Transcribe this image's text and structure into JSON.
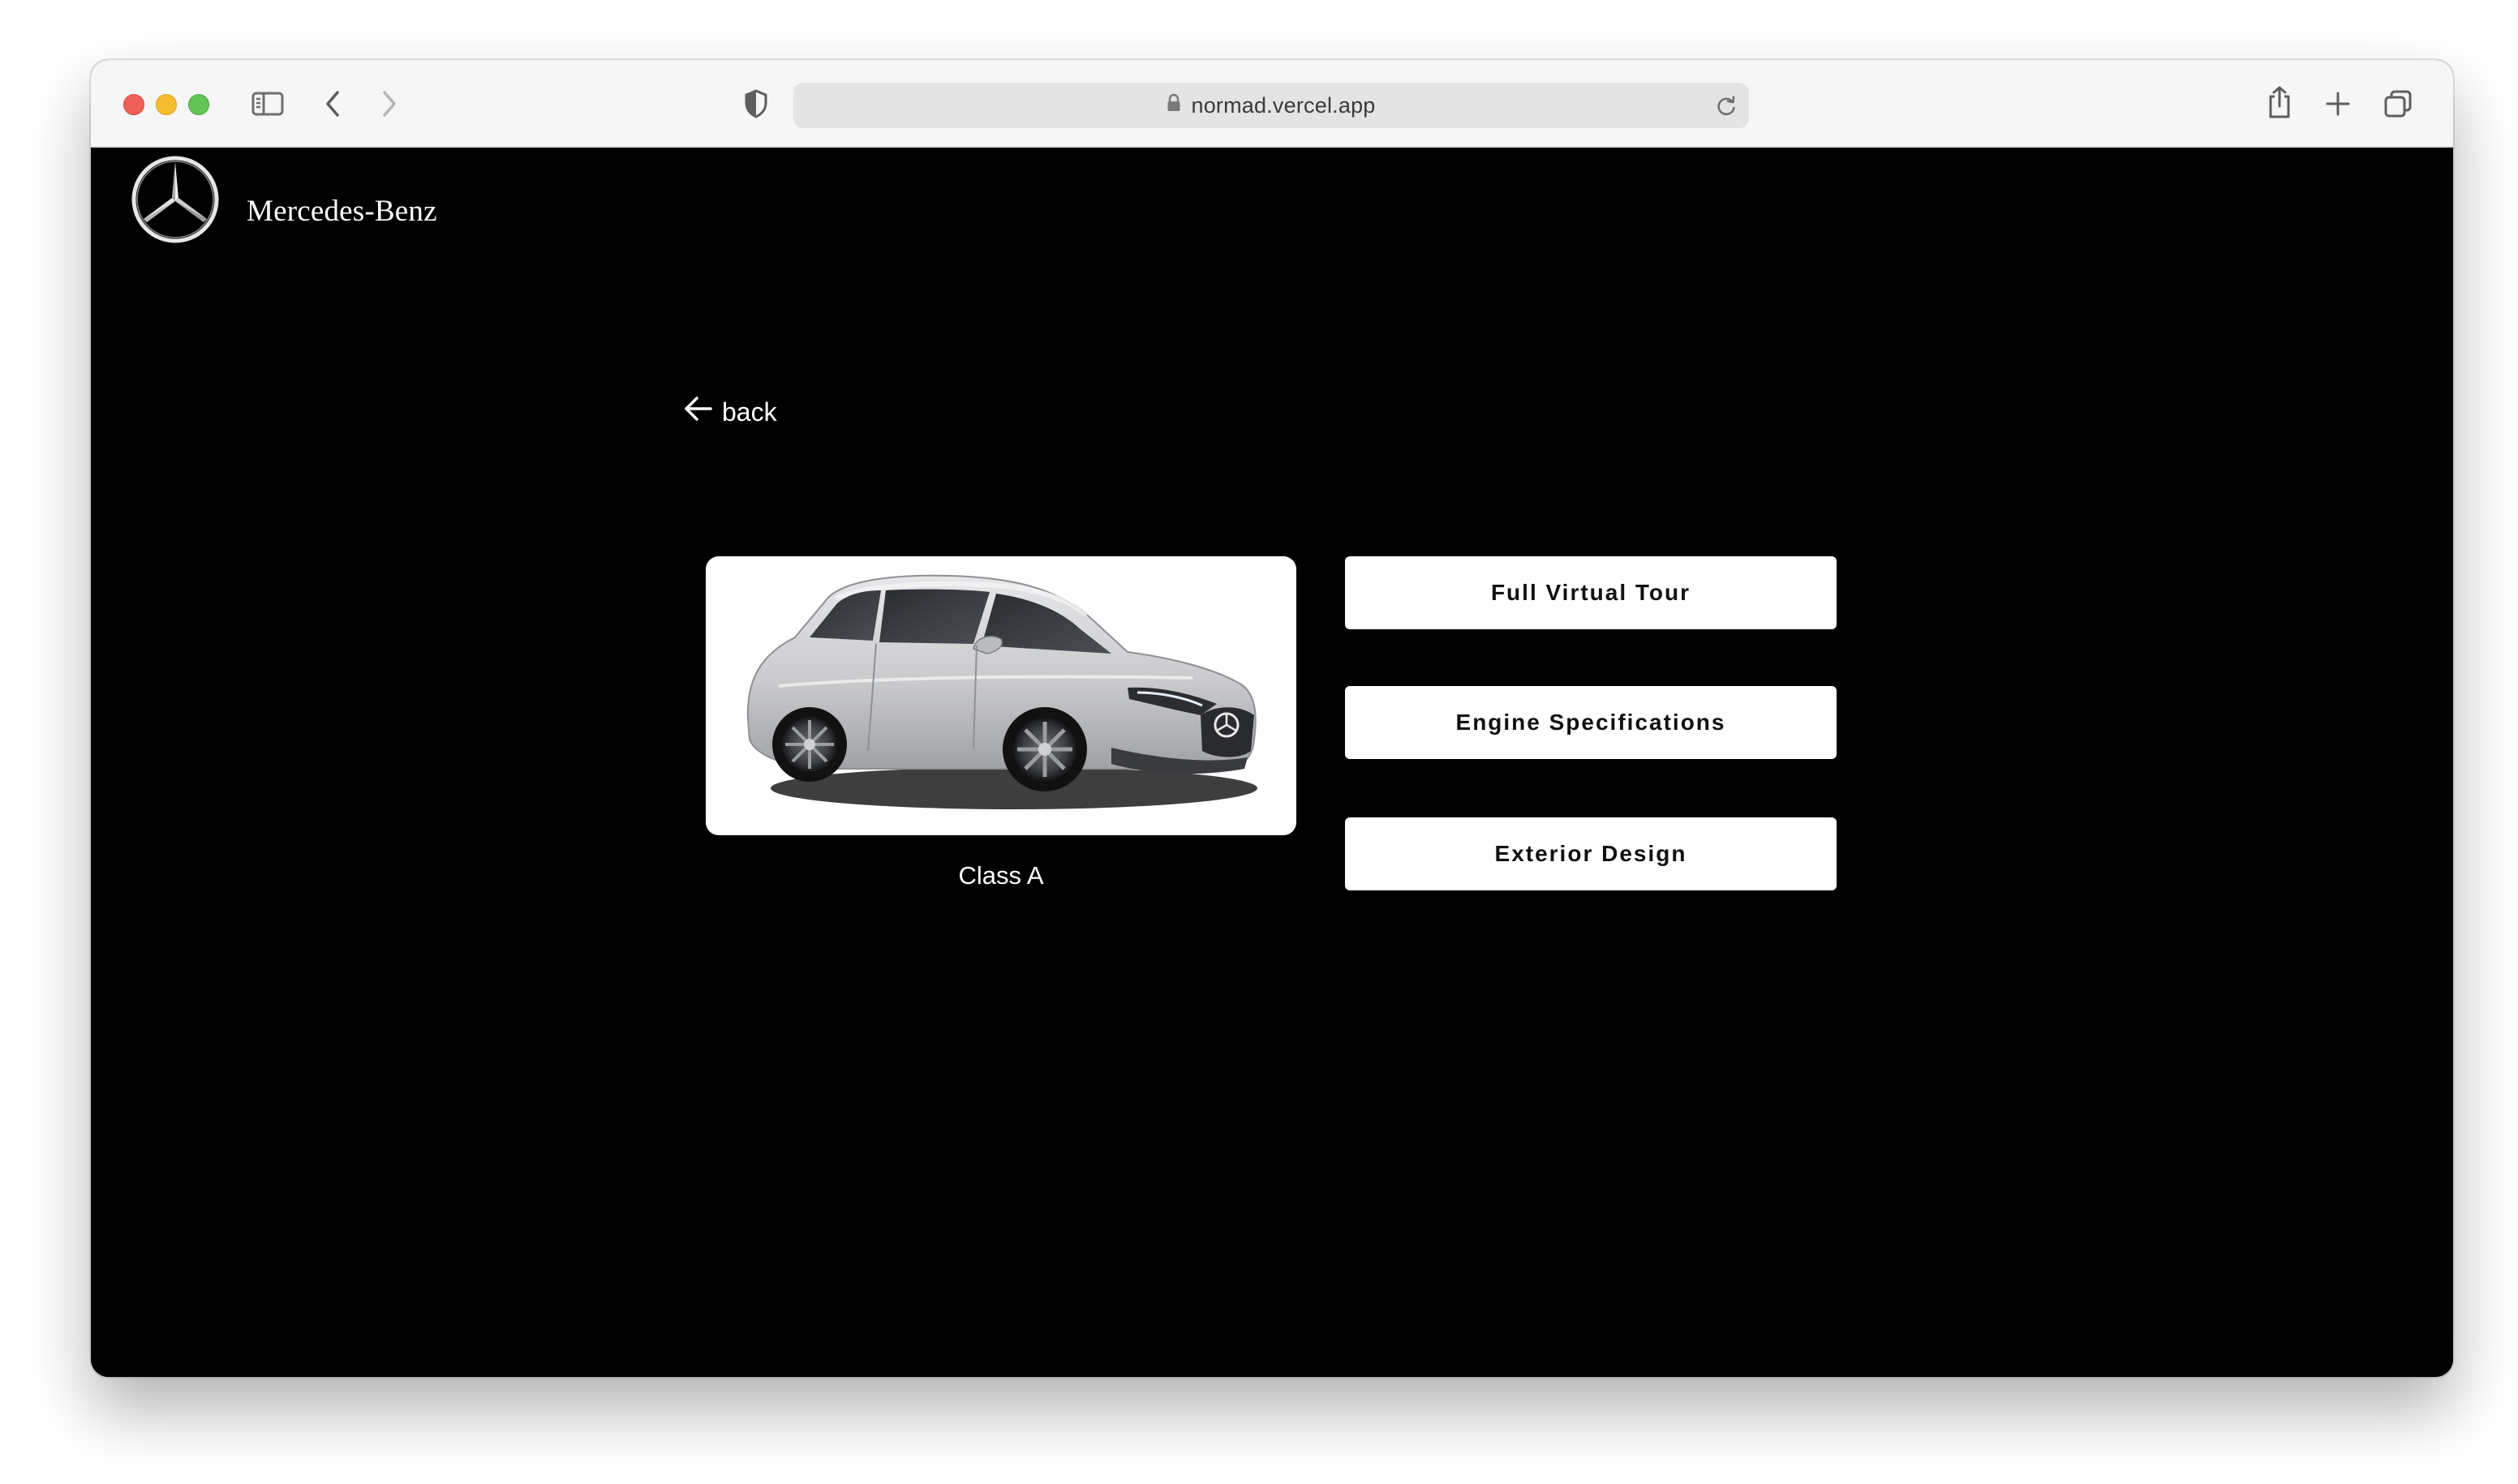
{
  "browser": {
    "url": "normad.vercel.app"
  },
  "brand": {
    "name": "Mercedes-Benz",
    "logo_icon": "mercedes-star-icon"
  },
  "nav": {
    "back_label": "back",
    "back_icon": "arrow-left-icon"
  },
  "car": {
    "model_label": "Class A",
    "body_color": "#c8c9cb"
  },
  "actions": [
    {
      "label": "Full Virtual Tour"
    },
    {
      "label": "Engine Specifications"
    },
    {
      "label": "Exterior Design"
    }
  ],
  "colors": {
    "page_background": "#000000",
    "button_background": "#ffffff",
    "button_text": "#111111"
  }
}
